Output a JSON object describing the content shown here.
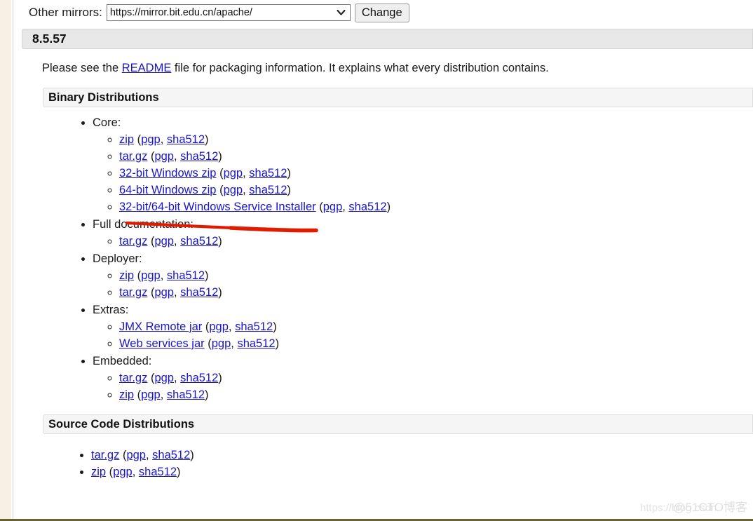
{
  "mirrors": {
    "label": "Other mirrors:",
    "selected_url": "https://mirror.bit.edu.cn/apache/",
    "dropdown_icon": "chevron-down-icon",
    "change_label": "Change"
  },
  "version_header": "8.5.57",
  "intro": {
    "before": "Please see the ",
    "link": "README",
    "after": " file for packaging information. It explains what every distribution contains."
  },
  "binary": {
    "header": "Binary Distributions",
    "groups": [
      {
        "label": "Core:",
        "items": [
          {
            "name": "zip",
            "pgp": "pgp",
            "sha": "sha512"
          },
          {
            "name": "tar.gz",
            "pgp": "pgp",
            "sha": "sha512"
          },
          {
            "name": "32-bit Windows zip",
            "pgp": "pgp",
            "sha": "sha512"
          },
          {
            "name": "64-bit Windows zip",
            "pgp": "pgp",
            "sha": "sha512"
          },
          {
            "name": "32-bit/64-bit Windows Service Installer",
            "pgp": "pgp",
            "sha": "sha512"
          }
        ]
      },
      {
        "label": "Full documentation:",
        "items": [
          {
            "name": "tar.gz",
            "pgp": "pgp",
            "sha": "sha512"
          }
        ]
      },
      {
        "label": "Deployer:",
        "items": [
          {
            "name": "zip",
            "pgp": "pgp",
            "sha": "sha512"
          },
          {
            "name": "tar.gz",
            "pgp": "pgp",
            "sha": "sha512"
          }
        ]
      },
      {
        "label": "Extras:",
        "items": [
          {
            "name": "JMX Remote jar",
            "pgp": "pgp",
            "sha": "sha512"
          },
          {
            "name": "Web services jar",
            "pgp": "pgp",
            "sha": "sha512"
          }
        ]
      },
      {
        "label": "Embedded:",
        "items": [
          {
            "name": "tar.gz",
            "pgp": "pgp",
            "sha": "sha512"
          },
          {
            "name": "zip",
            "pgp": "pgp",
            "sha": "sha512"
          }
        ]
      }
    ]
  },
  "source": {
    "header": "Source Code Distributions",
    "items": [
      {
        "name": "tar.gz",
        "pgp": "pgp",
        "sha": "sha512"
      },
      {
        "name": "zip",
        "pgp": "pgp",
        "sha": "sha512"
      }
    ]
  },
  "annotation": {
    "kind": "red-underline-stroke",
    "target": "64-bit Windows zip (pgp, sha512)",
    "color": "#e01b00"
  },
  "watermarks": {
    "url": "https://blog.csdn",
    "brand": "@51CTO博客"
  },
  "colors": {
    "link": "#1a16c8",
    "version_bar": "#e8e8e8",
    "panel_bar": "#f5f5f5",
    "annotation_red": "#e01b00",
    "left_strip": "#f7f0e4",
    "bottom_rule": "#6b6233"
  }
}
